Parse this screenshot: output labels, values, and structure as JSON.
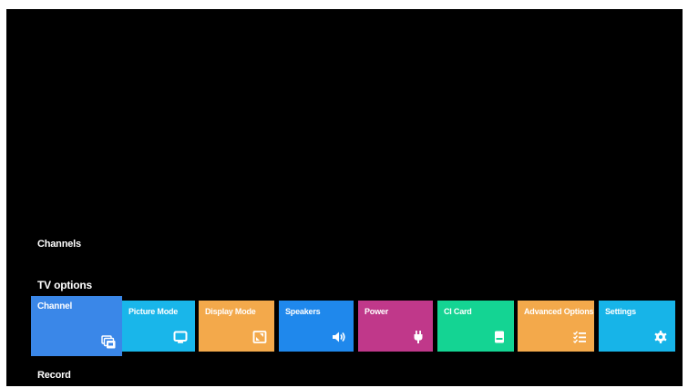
{
  "rows": {
    "channels_label": "Channels",
    "tv_options_label": "TV options",
    "record_label": "Record"
  },
  "tiles": [
    {
      "label": "Channel",
      "color": "#3a87e8",
      "icon": "channel-stack-icon",
      "focused": true
    },
    {
      "label": "Picture Mode",
      "color": "#19b6ea",
      "icon": "monitor-icon",
      "focused": false
    },
    {
      "label": "Display Mode",
      "color": "#f3a94b",
      "icon": "aspect-ratio-icon",
      "focused": false
    },
    {
      "label": "Speakers",
      "color": "#1f88ec",
      "icon": "speaker-icon",
      "focused": false
    },
    {
      "label": "Power",
      "color": "#c0388a",
      "icon": "power-plug-icon",
      "focused": false
    },
    {
      "label": "CI Card",
      "color": "#14d493",
      "icon": "sd-card-icon",
      "focused": false
    },
    {
      "label": "Advanced Options",
      "color": "#f3a94b",
      "icon": "checklist-icon",
      "focused": false
    },
    {
      "label": "Settings",
      "color": "#17b4e8",
      "icon": "gear-icon",
      "focused": false
    }
  ]
}
